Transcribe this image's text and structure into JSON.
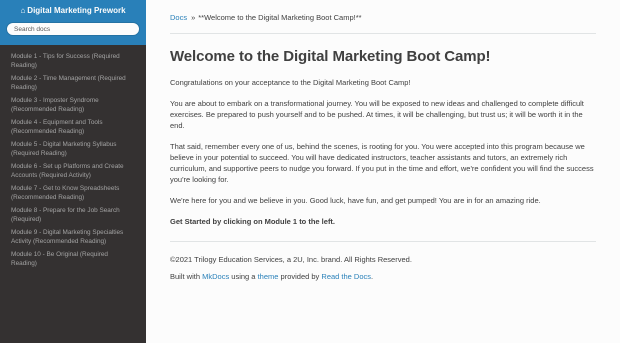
{
  "sidebar": {
    "title": "Digital Marketing Prework",
    "home_icon": "⌂",
    "search_placeholder": "Search docs",
    "items": [
      "Module 1 - Tips for Success (Required Reading)",
      "Module 2 - Time Management (Required Reading)",
      "Module 3 - Imposter Syndrome (Recommended Reading)",
      "Module 4 - Equipment and Tools (Recommended Reading)",
      "Module 5 - Digital Marketing Syllabus (Required Reading)",
      "Module 6 - Set up Platforms and Create Accounts (Required Activity)",
      "Module 7 - Get to Know Spreadsheets (Recommended Reading)",
      "Module 8 - Prepare for the Job Search (Required)",
      "Module 9 - Digital Marketing Specialties Activity (Recommended Reading)",
      "Module 10 - Be Original (Required Reading)"
    ]
  },
  "breadcrumb": {
    "docs": "Docs",
    "separator": "»",
    "current": "**Welcome to the Digital Marketing Boot Camp!**"
  },
  "main": {
    "title": "Welcome to the Digital Marketing Boot Camp!",
    "paragraphs": [
      "Congratulations on your acceptance to the Digital Marketing Boot Camp!",
      "You are about to embark on a transformational journey. You will be exposed to new ideas and challenged to complete difficult exercises. Be prepared to push yourself and to be pushed. At times, it will be challenging, but trust us; it will be worth it in the end.",
      "That said, remember every one of us, behind the scenes, is rooting for you. You were accepted into this program because we believe in your potential to succeed. You will have dedicated instructors, teacher assistants and tutors, an extremely rich curriculum, and supportive peers to nudge you forward. If you put in the time and effort, we're confident you will find the success you're looking for.",
      "We're here for you and we believe in you. Good luck, have fun, and get pumped! You are in for an amazing ride.",
      "Get Started by clicking on Module 1 to the left."
    ]
  },
  "footer": {
    "copyright": "©2021 Trilogy Education Services, a 2U, Inc. brand. All Rights Reserved.",
    "built_with": "Built with",
    "mkdocs": "MkDocs",
    "using_a": "using a",
    "theme": "theme",
    "provided_by": "provided by",
    "read_the_docs": "Read the Docs",
    "period": "."
  },
  "colors": {
    "sidebar_bg": "#343131",
    "header_bg": "#2980b9",
    "link": "#2980b9",
    "text": "#404040"
  }
}
